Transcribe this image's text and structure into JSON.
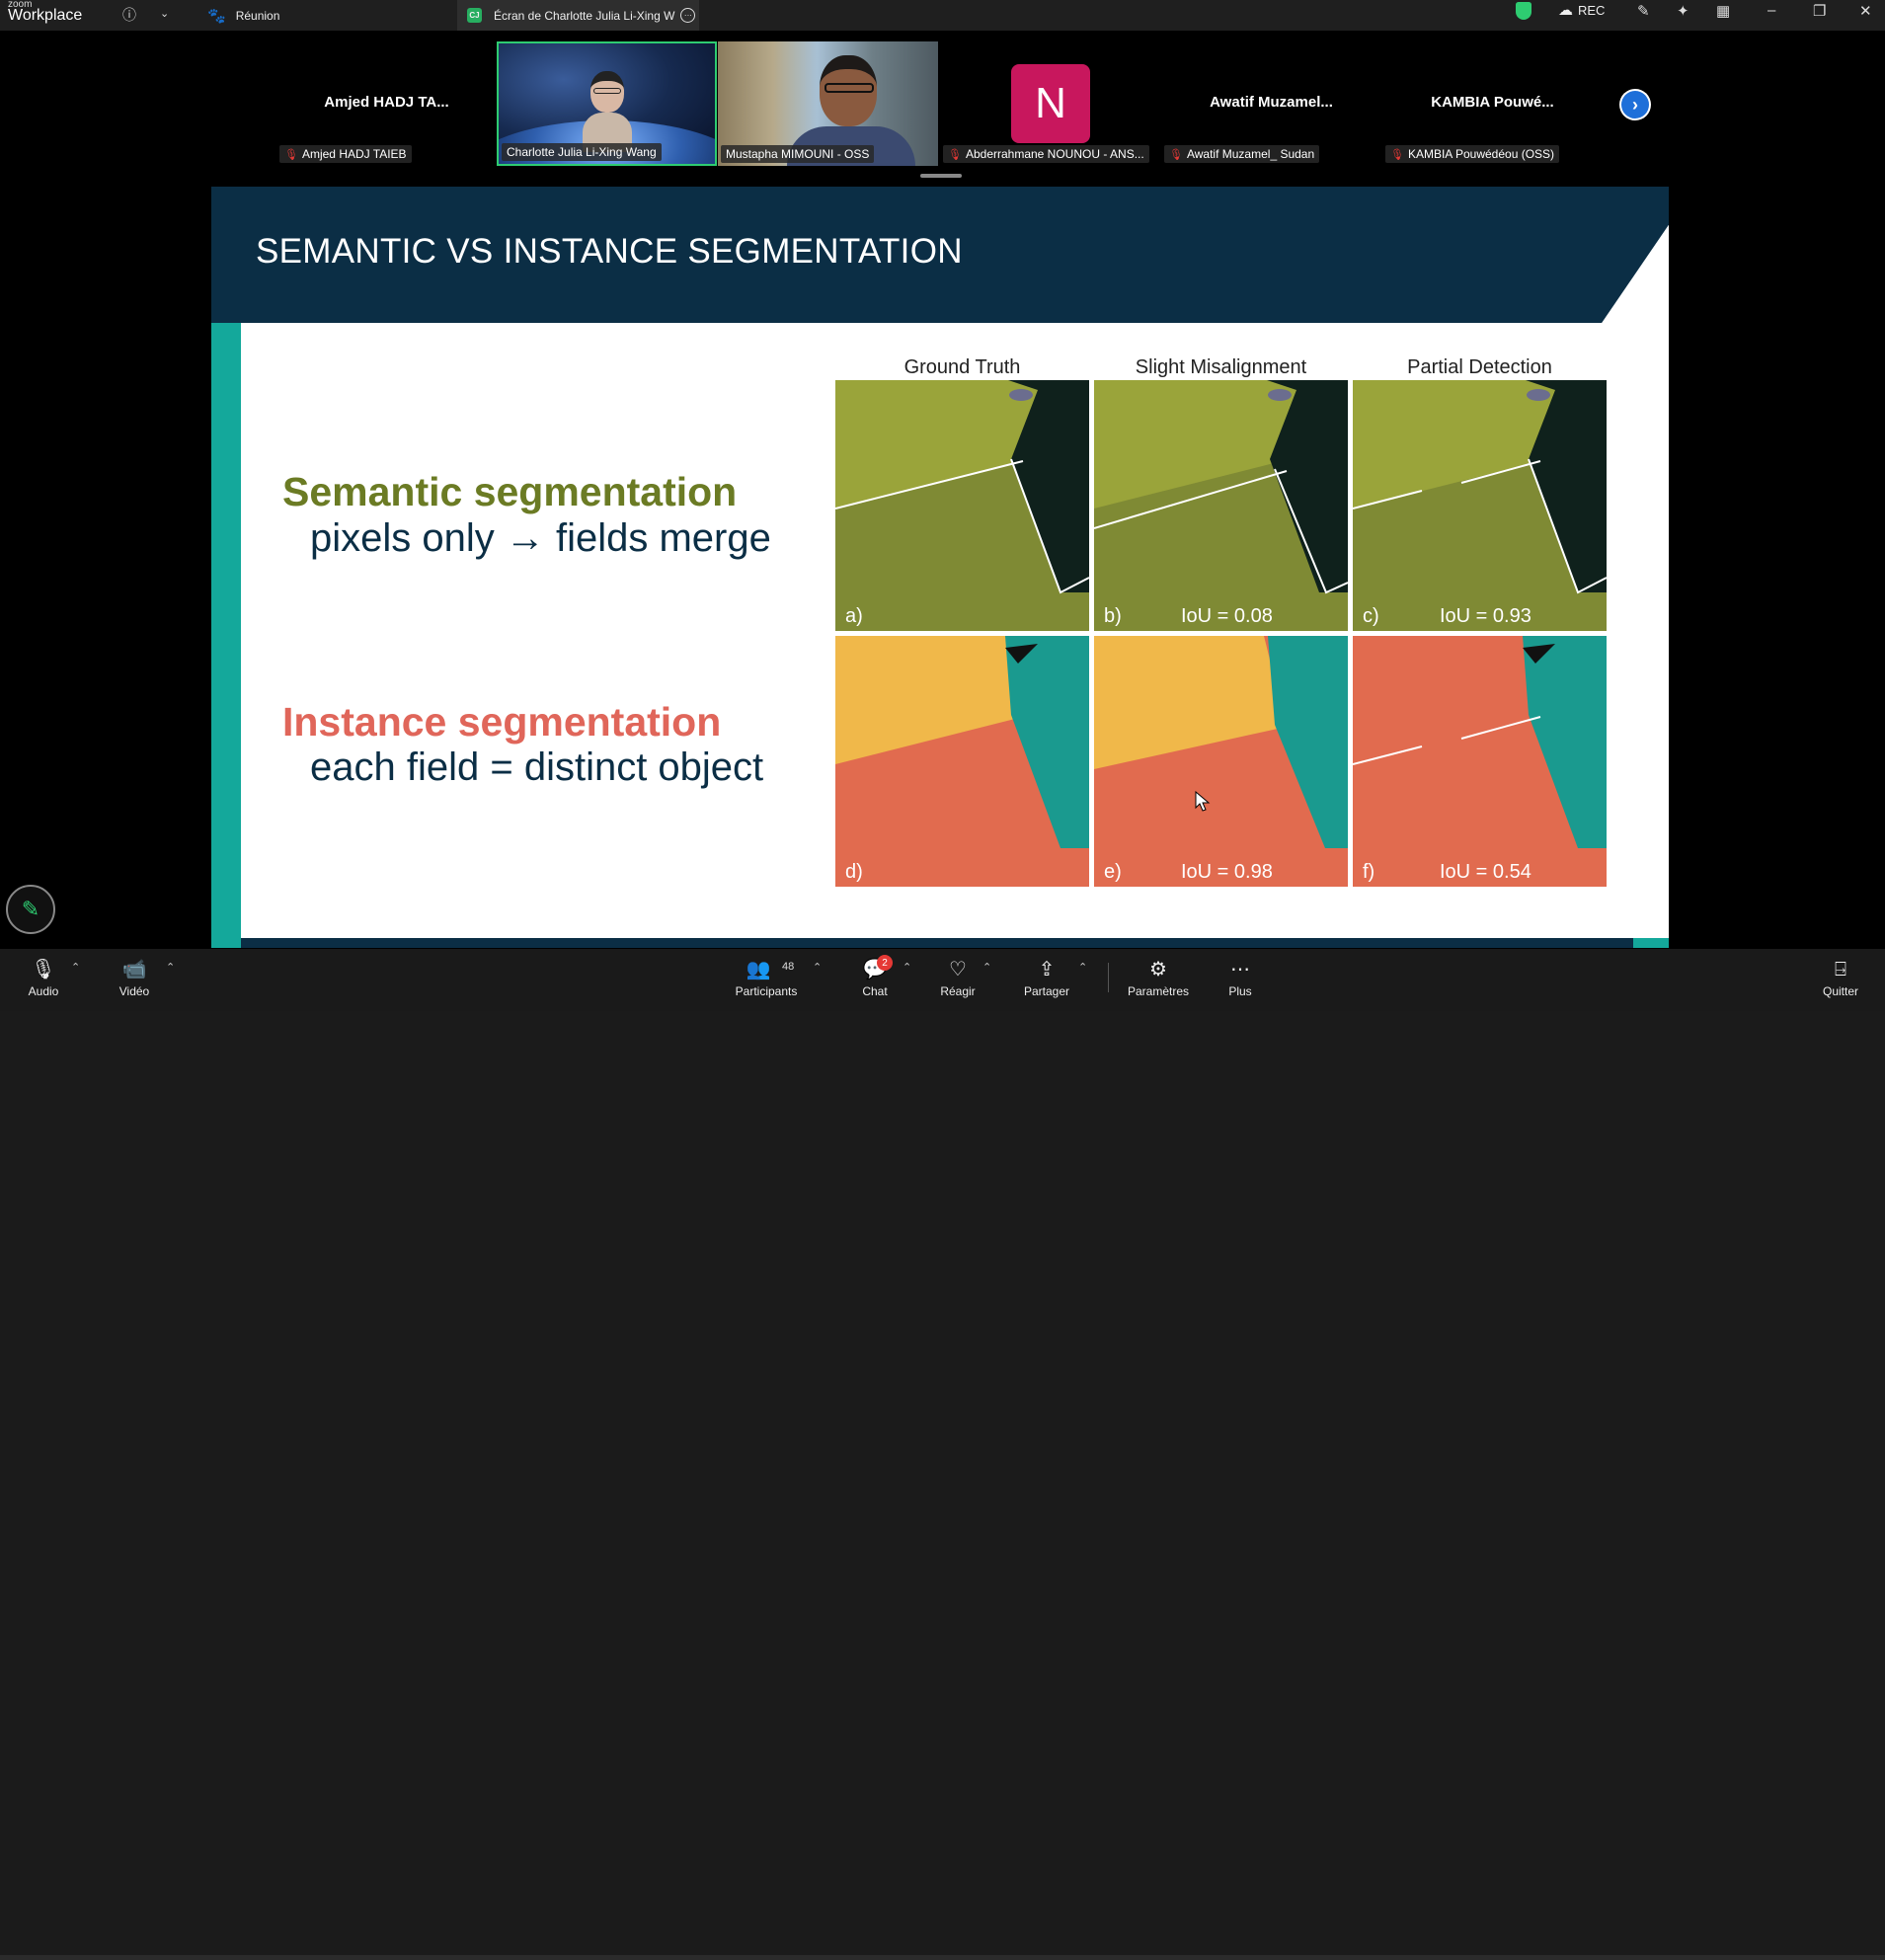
{
  "topbar": {
    "brand_small": "zoom",
    "brand": "Workplace",
    "meeting_tab": "Réunion",
    "screen_tab": "Écran de Charlotte Julia Li-Xing W",
    "screen_tab_initials": "CJ",
    "rec_label": "REC"
  },
  "gallery": {
    "tiles": [
      {
        "name": "Amjed HADJ TA...",
        "label": "Amjed HADJ TAIEB",
        "muted": true
      },
      {
        "name": "",
        "label": "Charlotte Julia Li-Xing Wang",
        "muted": false,
        "active_speaker": true
      },
      {
        "name": "",
        "label": "Mustapha MIMOUNI - OSS",
        "muted": false
      },
      {
        "name": "N",
        "label": "Abderrahmane NOUNOU - ANS...",
        "muted": true,
        "avatar_color": "#c8175d"
      },
      {
        "name": "Awatif  Muzamel...",
        "label": "Awatif Muzamel_ Sudan",
        "muted": true
      },
      {
        "name": "KAMBIA  Pouwé...",
        "label": "KAMBIA Pouwédéou (OSS)",
        "muted": true
      }
    ]
  },
  "slide": {
    "title": "SEMANTIC VS INSTANCE SEGMENTATION",
    "semantic_heading": "Semantic segmentation",
    "semantic_sub": "pixels only → fields merge",
    "instance_heading": "Instance segmentation",
    "instance_sub": "each field = distinct object",
    "columns": [
      "Ground Truth",
      "Slight Misalignment",
      "Partial Detection"
    ],
    "panels": [
      {
        "label": "a)",
        "iou": ""
      },
      {
        "label": "b)",
        "iou": "IoU = 0.08"
      },
      {
        "label": "c)",
        "iou": "IoU = 0.93"
      },
      {
        "label": "d)",
        "iou": ""
      },
      {
        "label": "e)",
        "iou": "IoU = 0.98"
      },
      {
        "label": "f)",
        "iou": "IoU = 0.54"
      }
    ],
    "colors": {
      "header": "#0b2e45",
      "accent": "#14a89b",
      "semantic": "#6b7b24",
      "instance": "#e0665a"
    }
  },
  "toolbar": {
    "audio": "Audio",
    "video": "Vidéo",
    "participants": "Participants",
    "participants_count": "48",
    "chat": "Chat",
    "chat_badge": "2",
    "react": "Réagir",
    "share": "Partager",
    "settings": "Paramètres",
    "more": "Plus",
    "quit": "Quitter"
  }
}
